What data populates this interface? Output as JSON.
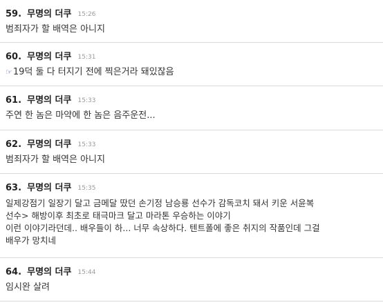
{
  "comments": [
    {
      "num": "59.",
      "author": "무명의 더쿠",
      "time": "15:26",
      "icon": "",
      "text": "범죄자가 할 배역은 아니지"
    },
    {
      "num": "60.",
      "author": "무명의 더쿠",
      "time": "15:31",
      "icon": "☞",
      "text": "19덕 둘 다 터지기 전에 찍은거라 돼있잖음"
    },
    {
      "num": "61.",
      "author": "무명의 더쿠",
      "time": "15:33",
      "icon": "",
      "text": "주연 한 놈은 마약에 한 놈은 음주운전..."
    },
    {
      "num": "62.",
      "author": "무명의 더쿠",
      "time": "15:33",
      "icon": "",
      "text": "범죄자가 할 배역은 아니지"
    },
    {
      "num": "63.",
      "author": "무명의 더쿠",
      "time": "15:35",
      "icon": "",
      "text": "일제강점기 일장기 달고 금메달 땄던 손기정 남승룡 선수가 감독코치 돼서 키운 서윤복\n선수> 해방이후 최초로 태극마크 달고 마라톤 우승하는 이야기\n이런 이야기라던데.. 배우들이 하... 너무 속상하다. 텐트폴에 좋은 취지의 작품인데 그걸\n배우가 망치네"
    },
    {
      "num": "64.",
      "author": "무명의 더쿠",
      "time": "15:44",
      "icon": "",
      "text": "임시완 살려"
    }
  ]
}
